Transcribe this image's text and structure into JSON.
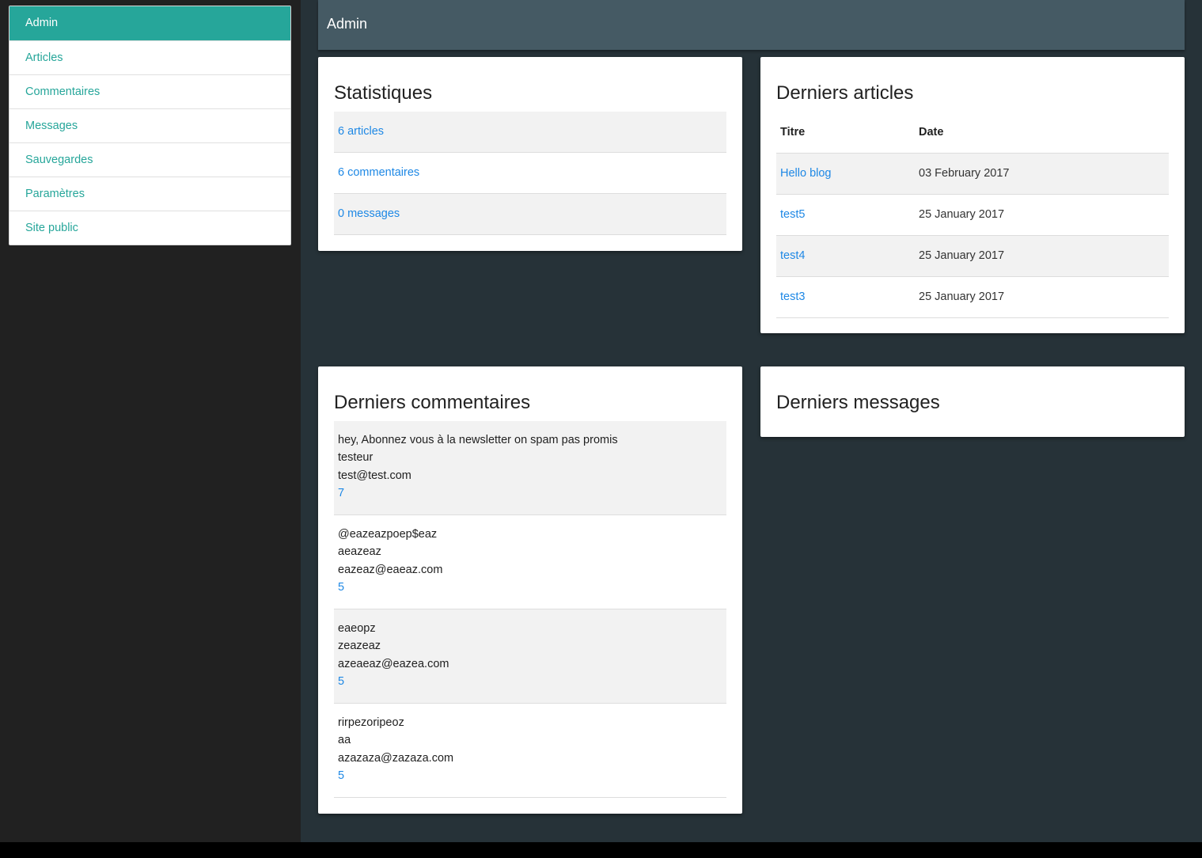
{
  "sidebar": {
    "items": [
      {
        "label": "Admin",
        "active": true
      },
      {
        "label": "Articles"
      },
      {
        "label": "Commentaires"
      },
      {
        "label": "Messages"
      },
      {
        "label": "Sauvegardes"
      },
      {
        "label": "Paramètres"
      },
      {
        "label": "Site public"
      }
    ]
  },
  "header": {
    "title": "Admin"
  },
  "stats": {
    "title": "Statistiques",
    "rows": [
      "6 articles",
      "6 commentaires",
      "0 messages"
    ]
  },
  "articles": {
    "title": "Derniers articles",
    "columns": [
      "Titre",
      "Date"
    ],
    "rows": [
      {
        "title": "Hello blog",
        "date": "03 February 2017"
      },
      {
        "title": "test5",
        "date": "25 January 2017"
      },
      {
        "title": "test4",
        "date": "25 January 2017"
      },
      {
        "title": "test3",
        "date": "25 January 2017"
      }
    ]
  },
  "comments": {
    "title": "Derniers commentaires",
    "items": [
      {
        "text": "hey, Abonnez vous à la newsletter on spam pas promis",
        "author": "testeur",
        "email": "test@test.com",
        "article_id": "7"
      },
      {
        "text": "@eazeazpoep$eaz",
        "author": "aeazeaz",
        "email": "eazeaz@eaeaz.com",
        "article_id": "5"
      },
      {
        "text": "eaeopz",
        "author": "zeazeaz",
        "email": "azeaeaz@eazea.com",
        "article_id": "5"
      },
      {
        "text": "rirpezoripeoz",
        "author": "aa",
        "email": "azazaza@zazaza.com",
        "article_id": "5"
      }
    ]
  },
  "messages": {
    "title": "Derniers messages"
  },
  "colors": {
    "accent": "#26a69a",
    "link": "#1e88e5",
    "header_bg": "#455a64",
    "content_bg": "#263238",
    "sidebar_bg": "#212121"
  }
}
